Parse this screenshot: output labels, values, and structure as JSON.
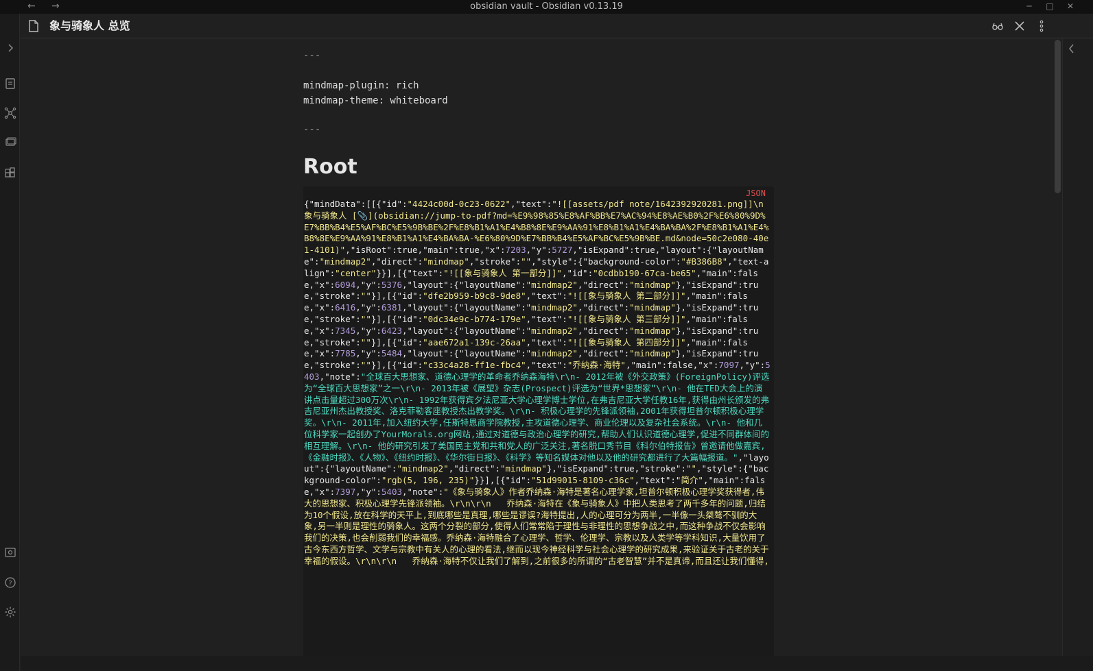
{
  "window": {
    "title": "obsidian vault - Obsidian v0.13.19",
    "back_glyph": "←",
    "forward_glyph": "→",
    "minimize_glyph": "─",
    "maximize_glyph": "□",
    "close_glyph": "✕"
  },
  "ribbon": {
    "icons": [
      "chevron-right-icon",
      "file-explorer-icon",
      "graph-view-icon",
      "slides-icon",
      "plugins-icon",
      "vault-switcher-icon",
      "help-icon",
      "settings-icon"
    ]
  },
  "header": {
    "title": "象与骑象人 总览",
    "icons": [
      "reading-mode-icon",
      "close-pane-icon",
      "more-options-icon"
    ]
  },
  "note": {
    "frontmatter_open": "---",
    "frontmatter_line1": "mindmap-plugin: rich",
    "frontmatter_line2": "mindmap-theme: whiteboard",
    "frontmatter_close": "---",
    "heading": "Root",
    "code_language": "JSON",
    "code_segments": [
      {
        "c": "k",
        "t": "{\"mindData\":[[{\"id\":"
      },
      {
        "c": "s",
        "t": "\"4424c00d-0c23-0622\""
      },
      {
        "c": "k",
        "t": ",\"text\":"
      },
      {
        "c": "s",
        "t": "\"![[assets/pdf note/1642392920281.png]]\\n象与骑象人 [📎](obsidian://jump-to-pdf?md=%E9%98%85%E8%AF%BB%E7%AC%94%E8%AE%B0%2F%E6%80%9D%E7%BB%B4%E5%AF%BC%E5%9B%BE%2F%E8%B1%A1%E4%B8%8E%E9%AA%91%E8%B1%A1%E4%BA%BA%2F%E8%B1%A1%E4%B8%8E%E9%AA%91%E8%B1%A1%E4%BA%BA-%E6%80%9D%E7%BB%B4%E5%AF%BC%E5%9B%BE.md&node=50c2e080-40e1-4101)\""
      },
      {
        "c": "k",
        "t": ",\"isRoot\":true,\"main\":true,\"x\":"
      },
      {
        "c": "n",
        "t": "7203"
      },
      {
        "c": "k",
        "t": ",\"y\":"
      },
      {
        "c": "n",
        "t": "5727"
      },
      {
        "c": "k",
        "t": ",\"isExpand\":true,\"layout\":{\"layoutName\":"
      },
      {
        "c": "s",
        "t": "\"mindmap2\""
      },
      {
        "c": "k",
        "t": ",\"direct\":"
      },
      {
        "c": "s",
        "t": "\"mindmap\""
      },
      {
        "c": "k",
        "t": ",\"stroke\":"
      },
      {
        "c": "s",
        "t": "\"\""
      },
      {
        "c": "k",
        "t": ",\"style\":{\"background-color\":"
      },
      {
        "c": "s",
        "t": "\"#B386B8\""
      },
      {
        "c": "k",
        "t": ",\"text-align\":"
      },
      {
        "c": "s",
        "t": "\"center\""
      },
      {
        "c": "k",
        "t": "}}],[{\"text\":"
      },
      {
        "c": "s",
        "t": "\"![[象与骑象人 第一部分]]\""
      },
      {
        "c": "k",
        "t": ",\"id\":"
      },
      {
        "c": "s",
        "t": "\"0cdbb190-67ca-be65\""
      },
      {
        "c": "k",
        "t": ",\"main\":false,\"x\":"
      },
      {
        "c": "n",
        "t": "6094"
      },
      {
        "c": "k",
        "t": ",\"y\":"
      },
      {
        "c": "n",
        "t": "5376"
      },
      {
        "c": "k",
        "t": ",\"layout\":{\"layoutName\":"
      },
      {
        "c": "s",
        "t": "\"mindmap2\""
      },
      {
        "c": "k",
        "t": ",\"direct\":"
      },
      {
        "c": "s",
        "t": "\"mindmap\""
      },
      {
        "c": "k",
        "t": "},\"isExpand\":true,\"stroke\":"
      },
      {
        "c": "s",
        "t": "\"\""
      },
      {
        "c": "k",
        "t": "}],[{\"id\":"
      },
      {
        "c": "s",
        "t": "\"dfe2b959-b9c8-9de8\""
      },
      {
        "c": "k",
        "t": ",\"text\":"
      },
      {
        "c": "s",
        "t": "\"![[象与骑象人 第二部分]]\""
      },
      {
        "c": "k",
        "t": ",\"main\":false,\"x\":"
      },
      {
        "c": "n",
        "t": "6416"
      },
      {
        "c": "k",
        "t": ",\"y\":"
      },
      {
        "c": "n",
        "t": "6381"
      },
      {
        "c": "k",
        "t": ",\"layout\":{\"layoutName\":"
      },
      {
        "c": "s",
        "t": "\"mindmap2\""
      },
      {
        "c": "k",
        "t": ",\"direct\":"
      },
      {
        "c": "s",
        "t": "\"mindmap\""
      },
      {
        "c": "k",
        "t": "},\"isExpand\":true,\"stroke\":"
      },
      {
        "c": "s",
        "t": "\"\""
      },
      {
        "c": "k",
        "t": "}],[{\"id\":"
      },
      {
        "c": "s",
        "t": "\"0dc34e9c-b774-179e\""
      },
      {
        "c": "k",
        "t": ",\"text\":"
      },
      {
        "c": "s",
        "t": "\"![[象与骑象人 第三部分]]\""
      },
      {
        "c": "k",
        "t": ",\"main\":false,\"x\":"
      },
      {
        "c": "n",
        "t": "7345"
      },
      {
        "c": "k",
        "t": ",\"y\":"
      },
      {
        "c": "n",
        "t": "6423"
      },
      {
        "c": "k",
        "t": ",\"layout\":{\"layoutName\":"
      },
      {
        "c": "s",
        "t": "\"mindmap2\""
      },
      {
        "c": "k",
        "t": ",\"direct\":"
      },
      {
        "c": "s",
        "t": "\"mindmap\""
      },
      {
        "c": "k",
        "t": "},\"isExpand\":true,\"stroke\":"
      },
      {
        "c": "s",
        "t": "\"\""
      },
      {
        "c": "k",
        "t": "}],[{\"id\":"
      },
      {
        "c": "s",
        "t": "\"aae672a1-139c-26aa\""
      },
      {
        "c": "k",
        "t": ",\"text\":"
      },
      {
        "c": "s",
        "t": "\"![[象与骑象人 第四部分]]\""
      },
      {
        "c": "k",
        "t": ",\"main\":false,\"x\":"
      },
      {
        "c": "n",
        "t": "7785"
      },
      {
        "c": "k",
        "t": ",\"y\":"
      },
      {
        "c": "n",
        "t": "5484"
      },
      {
        "c": "k",
        "t": ",\"layout\":{\"layoutName\":"
      },
      {
        "c": "s",
        "t": "\"mindmap2\""
      },
      {
        "c": "k",
        "t": ",\"direct\":"
      },
      {
        "c": "s",
        "t": "\"mindmap\""
      },
      {
        "c": "k",
        "t": "},\"isExpand\":true,\"stroke\":"
      },
      {
        "c": "s",
        "t": "\"\""
      },
      {
        "c": "k",
        "t": "}],[{\"id\":"
      },
      {
        "c": "s",
        "t": "\"c33c4a28-ff1e-fbc4\""
      },
      {
        "c": "k",
        "t": ",\"text\":"
      },
      {
        "c": "s",
        "t": "\"乔纳森·海特\""
      },
      {
        "c": "k",
        "t": ",\"main\":false,\"x\":"
      },
      {
        "c": "n",
        "t": "7097"
      },
      {
        "c": "k",
        "t": ",\"y\":"
      },
      {
        "c": "n",
        "t": "5403"
      },
      {
        "c": "k",
        "t": ",\"note\":"
      },
      {
        "c": "g",
        "t": "\"全球百大思想家、道德心理学的革命者乔纳森海特\\r\\n- 2012年被《外交政策》(ForeignPolicy)评选为“全球百大思想家”之一\\r\\n- 2013年被《展望》杂志(Prospect)评选为“世界*思想家”\\r\\n- 他在TED大会上的演讲点击量超过300万次\\r\\n- 1992年获得宾夕法尼亚大学心理学博士学位,在弗吉尼亚大学任教16年,获得由州长颁发的弗吉尼亚州杰出教授奖、洛克菲勒客座教授杰出教学奖。\\r\\n- 积极心理学的先锋派领袖,2001年获得坦普尔顿积极心理学奖。\\r\\n- 2011年,加入纽约大学,任斯特恩商学院教授,主攻道德心理学、商业伦理以及复杂社会系统。\\r\\n- 他和几位科学家一起创办了YourMorals.org网站,通过对道德与政治心理学的研究,帮助人们认识道德心理学,促进不同群体间的相互理解。\\r\\n- 他的研究引发了美国民主党和共和党人的广泛关注,著名脱口秀节目《科尔伯特报告》曾邀请他做嘉宾,《金融时报》、《人物》、《纽约时报》、《华尔街日报》、《科学》等知名媒体对他以及他的研究都进行了大篇幅报道。\""
      },
      {
        "c": "k",
        "t": ",\"layout\":{\"layoutName\":"
      },
      {
        "c": "s",
        "t": "\"mindmap2\""
      },
      {
        "c": "k",
        "t": ",\"direct\":"
      },
      {
        "c": "s",
        "t": "\"mindmap\""
      },
      {
        "c": "k",
        "t": "},\"isExpand\":true,\"stroke\":"
      },
      {
        "c": "s",
        "t": "\"\""
      },
      {
        "c": "k",
        "t": ",\"style\":{\"background-color\":"
      },
      {
        "c": "s",
        "t": "\"rgb(5, 196, 235)\""
      },
      {
        "c": "k",
        "t": "}}],[{\"id\":"
      },
      {
        "c": "s",
        "t": "\"51d99015-8109-c36c\""
      },
      {
        "c": "k",
        "t": ",\"text\":"
      },
      {
        "c": "s",
        "t": "\"简介\""
      },
      {
        "c": "k",
        "t": ",\"main\":false,\"x\":"
      },
      {
        "c": "n",
        "t": "7397"
      },
      {
        "c": "k",
        "t": ",\"y\":"
      },
      {
        "c": "n",
        "t": "5403"
      },
      {
        "c": "k",
        "t": ",\"note\":"
      },
      {
        "c": "s",
        "t": "\"《象与骑象人》作者乔纳森·海特是著名心理学家,坦普尔顿积极心理学奖获得者,伟大的思想家、积极心理学先锋派领袖。\\r\\n\\r\\n   乔纳森·海特在《象与骑象人》中把人类思考了两千多年的问题,归结为10个假设,放在科学的天平上,到底哪些是真理,哪些是谬误?海特提出,人的心理可分为两半,一半像一头桀骜不驯的大象,另一半则是理性的骑象人。这两个分裂的部分,使得人们常常陷于理性与非理性的思想争战之中,而这种争战不仅会影响我们的决策,也会削弱我们的幸福感。乔纳森·海特融合了心理学、哲学、伦理学、宗教以及人类学等学科知识,大量饮用了古今东西方哲学、文学与宗教中有关人的心理的看法,继而以现今神经科学与社会心理学的研究成果,来验证关于古老的关于幸福的假设。\\r\\n\\r\\n   乔纳森·海特不仅让我们了解到,之前很多的所谓的“古老智慧”并不是真谛,而且还让我们懂得,"
      }
    ]
  }
}
